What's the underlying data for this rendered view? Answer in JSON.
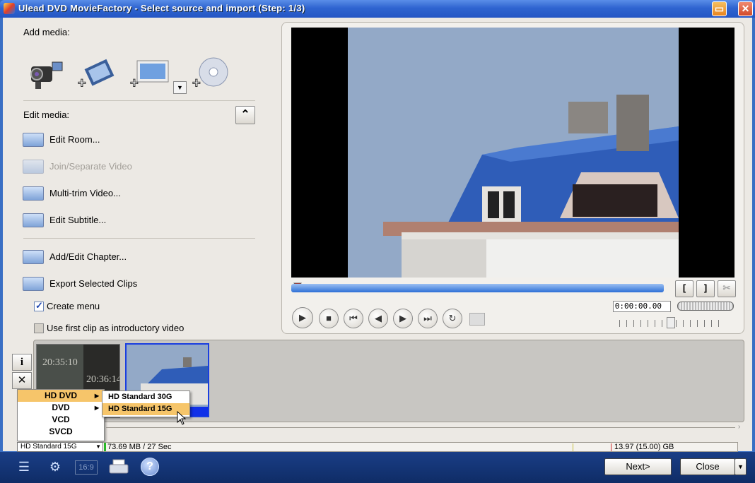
{
  "window": {
    "title": "Ulead DVD MovieFactory - Select source and import (Step: 1/3)",
    "minimize_glyph": "▭",
    "close_glyph": "✕"
  },
  "left_panel": {
    "add_media_label": "Add media:",
    "add_media_icons": [
      "camcorder-icon",
      "add-video-icon",
      "add-image-icon",
      "add-disc-icon"
    ],
    "edit_media_label": "Edit media:",
    "collapse_glyph": "⌃",
    "edit_items": [
      {
        "label": "Edit Room...",
        "enabled": true
      },
      {
        "label": "Join/Separate Video",
        "enabled": false
      },
      {
        "label": "Multi-trim Video...",
        "enabled": true
      },
      {
        "label": "Edit Subtitle...",
        "enabled": true
      }
    ],
    "chapter_items": [
      {
        "label": "Add/Edit Chapter...",
        "enabled": true
      },
      {
        "label": "Export Selected Clips",
        "enabled": true
      }
    ],
    "checkboxes": [
      {
        "label": "Create menu",
        "checked": true
      },
      {
        "label": "Use first clip as introductory video",
        "checked": false
      }
    ]
  },
  "preview": {
    "timecode": "0:00:00.00",
    "mark_in_glyph": "[",
    "mark_out_glyph": "]",
    "cut_glyph": "✂",
    "play_glyph": "▶",
    "stop_glyph": "■",
    "start_glyph": "⏮",
    "prev_frame_glyph": "◀",
    "next_frame_glyph": "▶",
    "end_glyph": "⏭",
    "repeat_glyph": "↻"
  },
  "clips": [
    {
      "overlay_times": [
        "20:35:10",
        "20:36:14"
      ],
      "selected": false
    },
    {
      "overlay_times": [],
      "selected": true
    }
  ],
  "side_buttons": [
    "i",
    "✕"
  ],
  "disc_menu": {
    "items": [
      {
        "label": "HD DVD",
        "highlighted": true,
        "submenu": true
      },
      {
        "label": "DVD",
        "highlighted": false,
        "submenu": true
      },
      {
        "label": "VCD",
        "highlighted": false,
        "submenu": false
      },
      {
        "label": "SVCD",
        "highlighted": false,
        "submenu": false
      }
    ],
    "submenu_items": [
      {
        "label": "HD Standard 30G",
        "highlighted": false
      },
      {
        "label": "HD Standard 15G",
        "highlighted": true
      }
    ]
  },
  "status": {
    "disc_select": "HD Standard 15G",
    "used": "73.69 MB / 27 Sec",
    "capacity": "13.97 (15.00) GB"
  },
  "bottom": {
    "next_label": "Next>",
    "close_label": "Close",
    "aspect_label": "16:9",
    "help_glyph": "?",
    "icons": [
      "menu-list-icon",
      "settings-icon",
      "aspect-ratio-icon",
      "printer-icon",
      "help-icon"
    ]
  },
  "colors": {
    "titlebar": "#2f64d0",
    "bottombar": "#1a3e86",
    "menu_highlight": "#f6c56a",
    "timeline": "#2d6fd6"
  }
}
